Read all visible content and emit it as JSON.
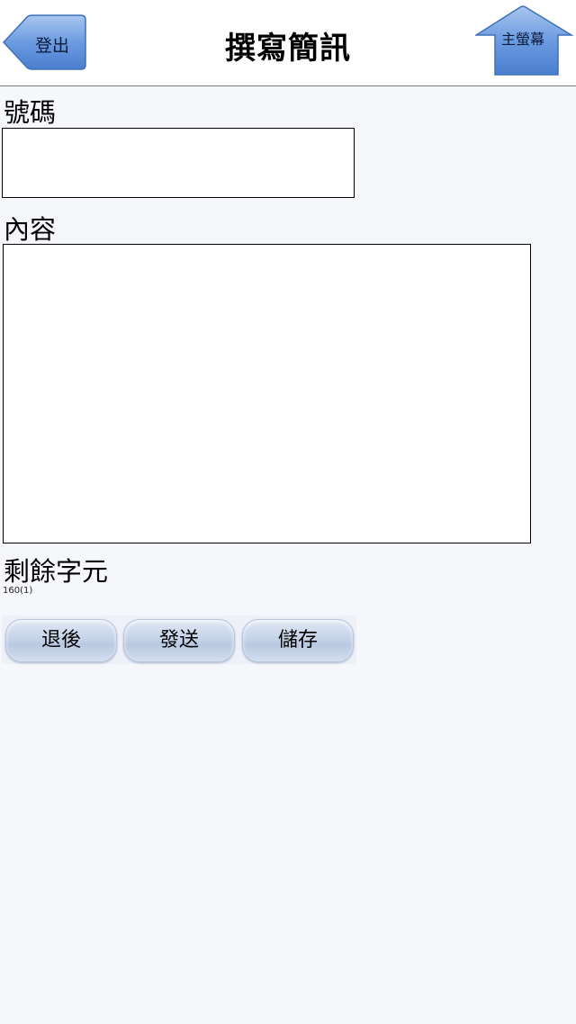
{
  "header": {
    "title": "撰寫簡訊",
    "logout_label": "登出",
    "home_label": "主螢幕"
  },
  "form": {
    "phone_label": "號碼",
    "phone_value": "",
    "content_label": "內容",
    "content_value": "",
    "remaining_label": "剩餘字元",
    "remaining_count": "160(1)"
  },
  "actions": {
    "back_label": "退後",
    "send_label": "發送",
    "save_label": "儲存"
  },
  "colors": {
    "nav_button_blue": "#5a8fd8",
    "background": "#f6f7fb"
  }
}
